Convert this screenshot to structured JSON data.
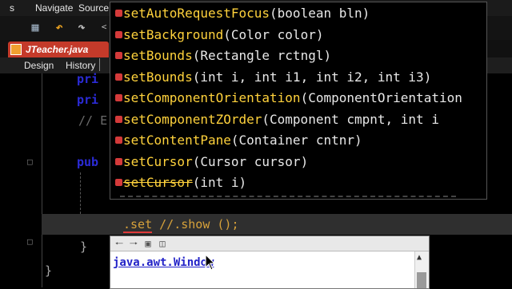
{
  "menubar": {
    "items": [
      "s",
      "Navigate",
      "Source"
    ]
  },
  "toolbar": {
    "icons": [
      "save-all-icon",
      "undo-icon",
      "redo-icon"
    ]
  },
  "file_tab": {
    "label": "JTeacher.java"
  },
  "subtabs": {
    "design": "Design",
    "history": "History"
  },
  "editor": {
    "lines": [
      {
        "text": "pri",
        "kind": "code"
      },
      {
        "text": "pri",
        "kind": "code"
      },
      {
        "text": "// E",
        "kind": "comment"
      },
      {
        "text": "pub",
        "kind": "code"
      }
    ],
    "current_line": {
      "prefix": ".set",
      "suffix": " //.show ();"
    },
    "closing_brace_1": "}",
    "closing_brace_2": "}"
  },
  "completion": {
    "items": [
      {
        "method": "setAutoRequestFocus",
        "params": "(boolean bln)",
        "deprecated": false
      },
      {
        "method": "setBackground",
        "params": "(Color color)",
        "deprecated": false
      },
      {
        "method": "setBounds",
        "params": "(Rectangle rctngl)",
        "deprecated": false
      },
      {
        "method": "setBounds",
        "params": "(int i, int i1, int i2, int i3)",
        "deprecated": false
      },
      {
        "method": "setComponentOrientation",
        "params": "(ComponentOrientation",
        "deprecated": false
      },
      {
        "method": "setComponentZOrder",
        "params": "(Component cmpnt, int i",
        "deprecated": false
      },
      {
        "method": "setContentPane",
        "params": "(Container cntnr)",
        "deprecated": false
      },
      {
        "method": "setCursor",
        "params": "(Cursor cursor)",
        "deprecated": false
      },
      {
        "method": "setCursor",
        "params": "(int i)",
        "deprecated": true
      }
    ]
  },
  "javadoc": {
    "link": "java.awt.Window",
    "buttons": [
      "back-icon",
      "forward-icon",
      "open-browser-icon",
      "copy-icon"
    ]
  },
  "colors": {
    "code_blue": "#2b2bd6",
    "current_line_bg": "#2f2f2f",
    "error_underline": "#e03a3a",
    "completion_method": "#ffd23c",
    "bullet_red": "#d43a3a",
    "tab_red": "#c43a2a"
  }
}
